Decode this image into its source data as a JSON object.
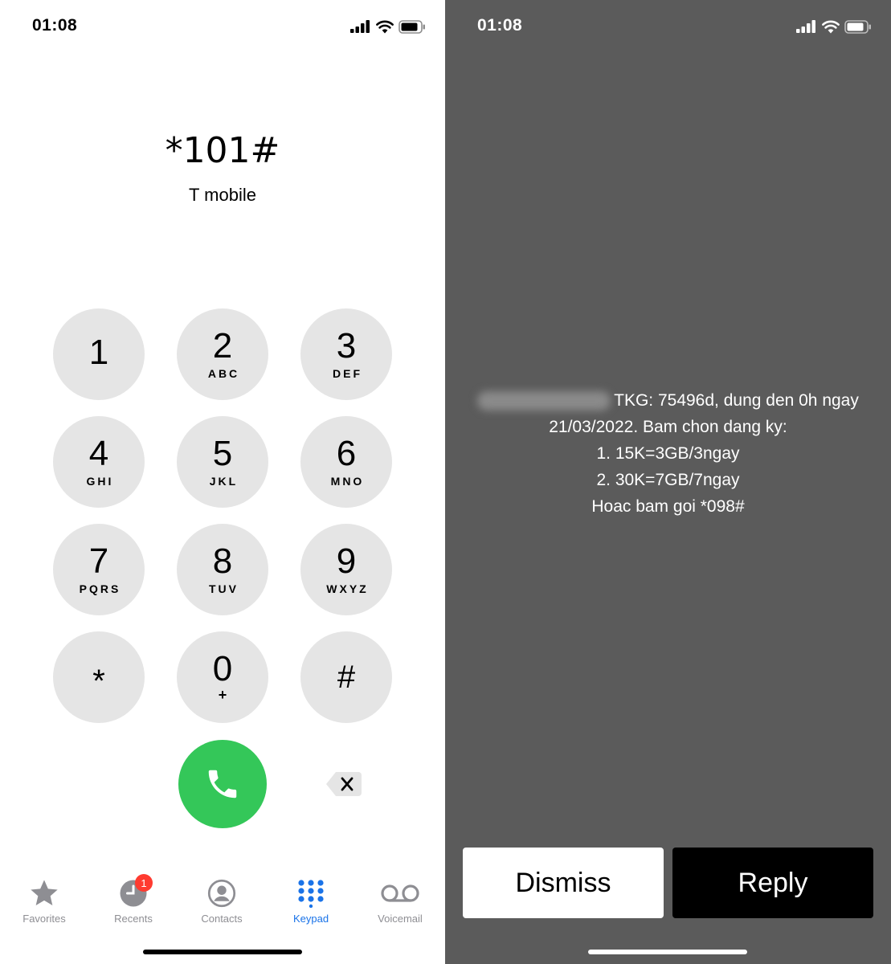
{
  "dialer": {
    "status_time": "01:08",
    "dialed_number": "*101#",
    "carrier": "T mobile",
    "keys": [
      {
        "digit": "1",
        "letters": ""
      },
      {
        "digit": "2",
        "letters": "ABC"
      },
      {
        "digit": "3",
        "letters": "DEF"
      },
      {
        "digit": "4",
        "letters": "GHI"
      },
      {
        "digit": "5",
        "letters": "JKL"
      },
      {
        "digit": "6",
        "letters": "MNO"
      },
      {
        "digit": "7",
        "letters": "PQRS"
      },
      {
        "digit": "8",
        "letters": "TUV"
      },
      {
        "digit": "9",
        "letters": "WXYZ"
      },
      {
        "digit": "*",
        "letters": ""
      },
      {
        "digit": "0",
        "letters": "+"
      },
      {
        "digit": "#",
        "letters": ""
      }
    ],
    "tabs": [
      {
        "label": "Favorites",
        "icon": "star-icon"
      },
      {
        "label": "Recents",
        "icon": "clock-icon",
        "badge": "1"
      },
      {
        "label": "Contacts",
        "icon": "person-circle-icon"
      },
      {
        "label": "Keypad",
        "icon": "keypad-grid-icon",
        "active": true
      },
      {
        "label": "Voicemail",
        "icon": "voicemail-icon"
      }
    ],
    "active_tab_color": "#1a73e8",
    "call_button_color": "#34c759",
    "badge_color": "#ff3b30"
  },
  "ussd": {
    "status_time": "01:08",
    "message_lines": [
      "TKG: 75496d, dung den 0h ngay",
      "21/03/2022. Bam chon dang ky:",
      "1. 15K=3GB/3ngay",
      "2. 30K=7GB/7ngay",
      "Hoac bam goi *098#"
    ],
    "dismiss_label": "Dismiss",
    "reply_label": "Reply",
    "background_color": "#5b5b5b"
  }
}
